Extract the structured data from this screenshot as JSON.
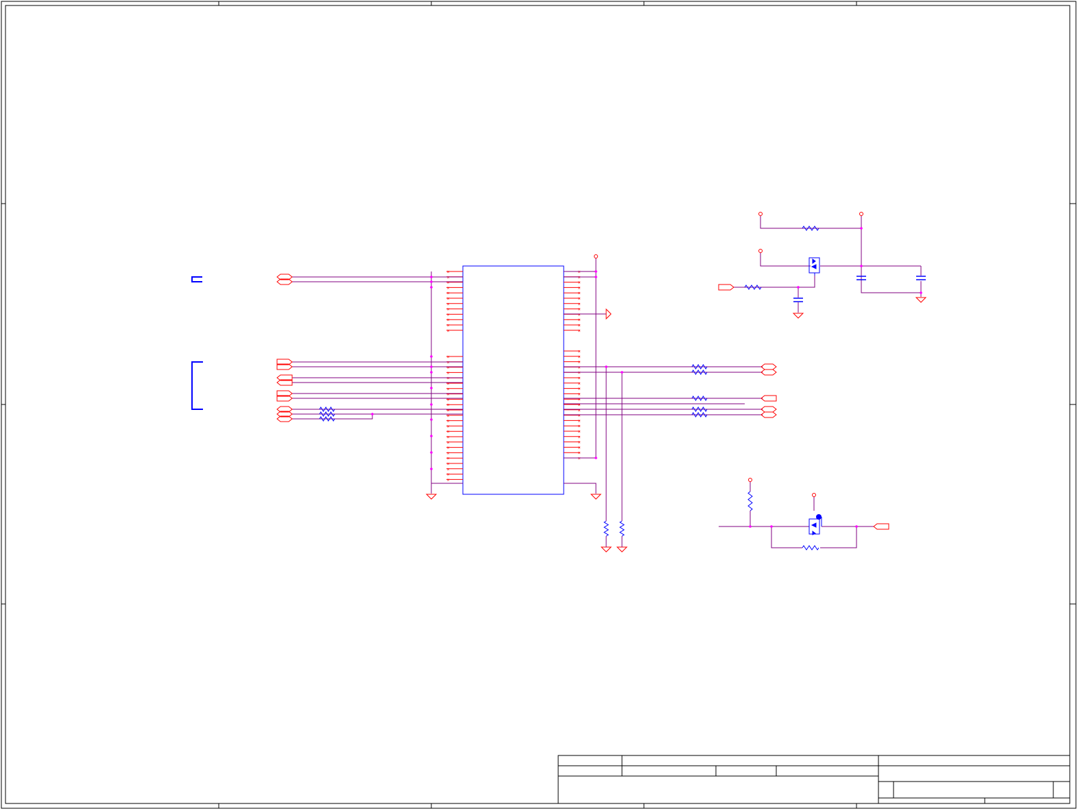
{
  "sheet": {
    "title_block": {
      "cells": [
        "",
        "",
        "",
        "",
        "",
        "",
        "",
        "",
        "",
        ""
      ]
    },
    "colors": {
      "border": "#000000",
      "wire": "#800080",
      "pin": "#ff0000",
      "component": "#0000ff",
      "junction": "#ff00ff",
      "background": "#ffffff"
    }
  },
  "components": [
    {
      "id": "main-ic",
      "type": "ic-box"
    },
    {
      "id": "connector-small",
      "type": "connector"
    },
    {
      "id": "connector-large",
      "type": "connector"
    },
    {
      "id": "resistor-array-left",
      "type": "resistor-array"
    },
    {
      "id": "resistor-array-right",
      "type": "resistor-array"
    },
    {
      "id": "pulldown-resistors",
      "type": "resistor"
    },
    {
      "id": "power-switch-mosfet",
      "type": "mosfet"
    },
    {
      "id": "level-shift-mosfet",
      "type": "mosfet"
    },
    {
      "id": "bulk-capacitors",
      "type": "capacitor"
    },
    {
      "id": "ground-symbols",
      "type": "ground"
    },
    {
      "id": "power-rail-symbols",
      "type": "power"
    }
  ]
}
